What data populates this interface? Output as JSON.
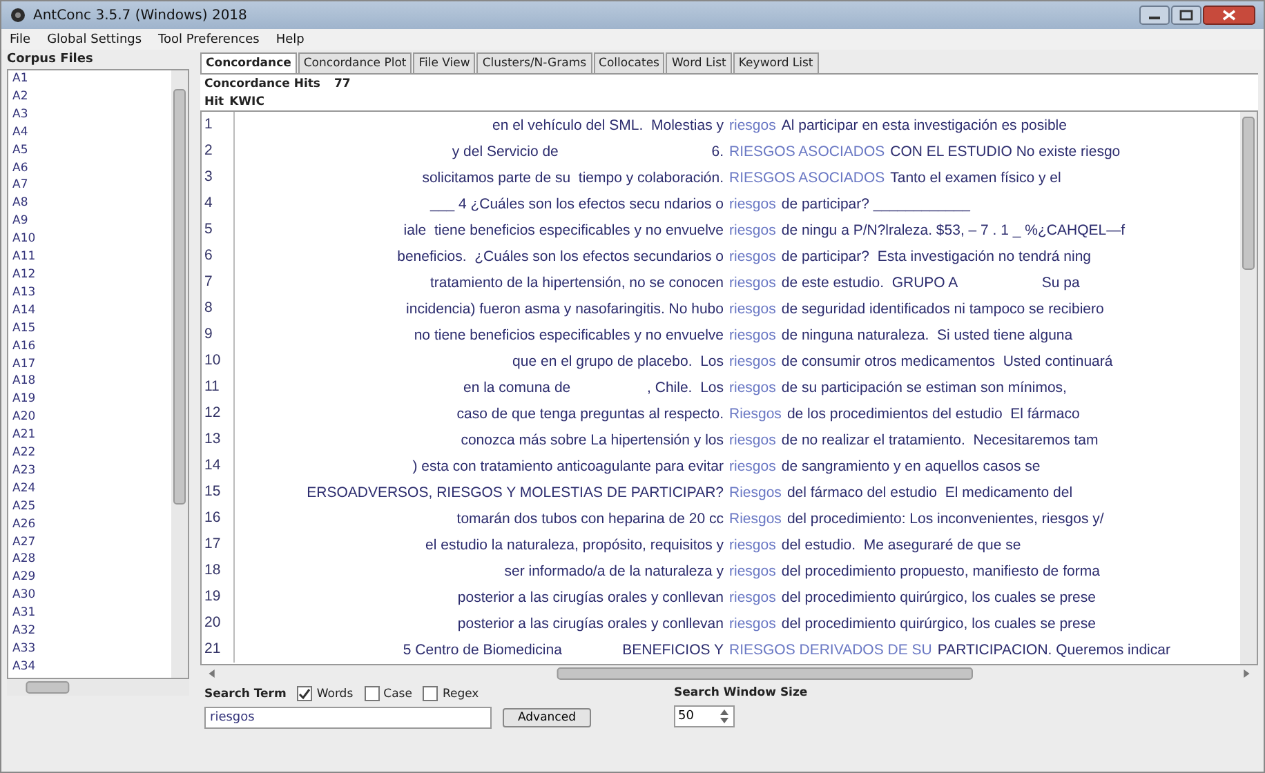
{
  "window": {
    "title": "AntConc 3.5.7 (Windows) 2018"
  },
  "menu": [
    "File",
    "Global Settings",
    "Tool Preferences",
    "Help"
  ],
  "corpus_files": {
    "title": "Corpus Files",
    "items": [
      "A1",
      "A2",
      "A3",
      "A4",
      "A5",
      "A6",
      "A7",
      "A8",
      "A9",
      "A10",
      "A11",
      "A12",
      "A13",
      "A14",
      "A15",
      "A16",
      "A17",
      "A18",
      "A19",
      "A20",
      "A21",
      "A22",
      "A23",
      "A24",
      "A25",
      "A26",
      "A27",
      "A28",
      "A29",
      "A30",
      "A31",
      "A32",
      "A33",
      "A34"
    ]
  },
  "tabs": [
    {
      "label": "Concordance",
      "selected": true
    },
    {
      "label": "Concordance Plot",
      "selected": false
    },
    {
      "label": "File View",
      "selected": false
    },
    {
      "label": "Clusters/N-Grams",
      "selected": false
    },
    {
      "label": "Collocates",
      "selected": false
    },
    {
      "label": "Word List",
      "selected": false
    },
    {
      "label": "Keyword List",
      "selected": false
    }
  ],
  "hits": {
    "label": "Concordance Hits",
    "count": "77"
  },
  "columns": [
    "Hit",
    "KWIC"
  ],
  "rows": [
    {
      "n": "1",
      "left": "en el vehículo del SML.  Molestias y",
      "hit": "riesgos",
      "right": "Al participar en esta investigación es posible"
    },
    {
      "n": "2",
      "left": "y del Servicio de                                      6.",
      "hit": "RIESGOS ASOCIADOS",
      "right": "CON EL ESTUDIO No existe riesgo"
    },
    {
      "n": "3",
      "left": "solicitamos parte de su  tiempo y colaboración.",
      "hit": "RIESGOS ASOCIADOS",
      "right": "Tanto el examen físico y el"
    },
    {
      "n": "4",
      "left": "___ 4 ¿Cuáles son los efectos secu ndarios o",
      "hit": "riesgos",
      "right": "de participar? ____________"
    },
    {
      "n": "5",
      "left": "iale  tiene beneficios especificables y no envuelve",
      "hit": "riesgos",
      "right": "de ningu a P/N?lraleza. $53, – 7 . 1 _ %¿CAHQEL—f"
    },
    {
      "n": "6",
      "left": "beneficios.  ¿Cuáles son los efectos secundarios o",
      "hit": "riesgos",
      "right": "de participar?  Esta investigación no tendrá ning"
    },
    {
      "n": "7",
      "left": "tratamiento de la hipertensión, no se conocen",
      "hit": "riesgos",
      "right": "de este estudio.  GRUPO A                     Su pa"
    },
    {
      "n": "8",
      "left": "incidencia) fueron asma y nasofaringitis. No hubo",
      "hit": "riesgos",
      "right": "de seguridad identificados ni tampoco se recibiero"
    },
    {
      "n": "9",
      "left": "no tiene beneficios especificables y no envuelve",
      "hit": "riesgos",
      "right": "de ninguna naturaleza.  Si usted tiene alguna"
    },
    {
      "n": "10",
      "left": "que en el grupo de placebo.  Los",
      "hit": "riesgos",
      "right": "de consumir otros medicamentos  Usted continuará"
    },
    {
      "n": "11",
      "left": "en la comuna de                   , Chile.  Los",
      "hit": "riesgos",
      "right": "de su participación se estiman son mínimos,"
    },
    {
      "n": "12",
      "left": "caso de que tenga preguntas al respecto.",
      "hit": "Riesgos",
      "right": "de los procedimientos del estudio  El fármaco"
    },
    {
      "n": "13",
      "left": "conozca más sobre La hipertensión y los",
      "hit": "riesgos",
      "right": "de no realizar el tratamiento.  Necesitaremos tam"
    },
    {
      "n": "14",
      "left": ") esta con tratamiento anticoagulante para evitar",
      "hit": "riesgos",
      "right": "de sangramiento y en aquellos casos se"
    },
    {
      "n": "15",
      "left": "ERSOADVERSOS, RIESGOS Y MOLESTIAS DE PARTICIPAR?",
      "hit": "Riesgos",
      "right": "del fármaco del estudio  El medicamento del"
    },
    {
      "n": "16",
      "left": "tomarán dos tubos con heparina de 20 cc",
      "hit": "Riesgos",
      "right": "del procedimiento: Los inconvenientes, riesgos y/"
    },
    {
      "n": "17",
      "left": "el estudio la naturaleza, propósito, requisitos y",
      "hit": "riesgos",
      "right": "del estudio.  Me aseguraré de que se"
    },
    {
      "n": "18",
      "left": "ser informado/a de la naturaleza y",
      "hit": "riesgos",
      "right": "del procedimiento propuesto, manifiesto de forma"
    },
    {
      "n": "19",
      "left": "posterior a las cirugías orales y conllevan",
      "hit": "riesgos",
      "right": "del procedimiento quirúrgico, los cuales se prese"
    },
    {
      "n": "20",
      "left": "posterior a las cirugías orales y conllevan",
      "hit": "riesgos",
      "right": "del procedimiento quirúrgico, los cuales se prese"
    },
    {
      "n": "21",
      "left": "5 Centro de Biomedicina               BENEFICIOS Y",
      "hit": "RIESGOS DERIVADOS DE SU",
      "right": "PARTICIPACION. Queremos indicar"
    }
  ],
  "search": {
    "label": "Search Term",
    "options": [
      {
        "label": "Words",
        "checked": true
      },
      {
        "label": "Case",
        "checked": false
      },
      {
        "label": "Regex",
        "checked": false
      }
    ],
    "value": "riesgos",
    "advanced_button": "Advanced"
  },
  "search_window": {
    "label": "Search Window Size",
    "value": "50"
  }
}
